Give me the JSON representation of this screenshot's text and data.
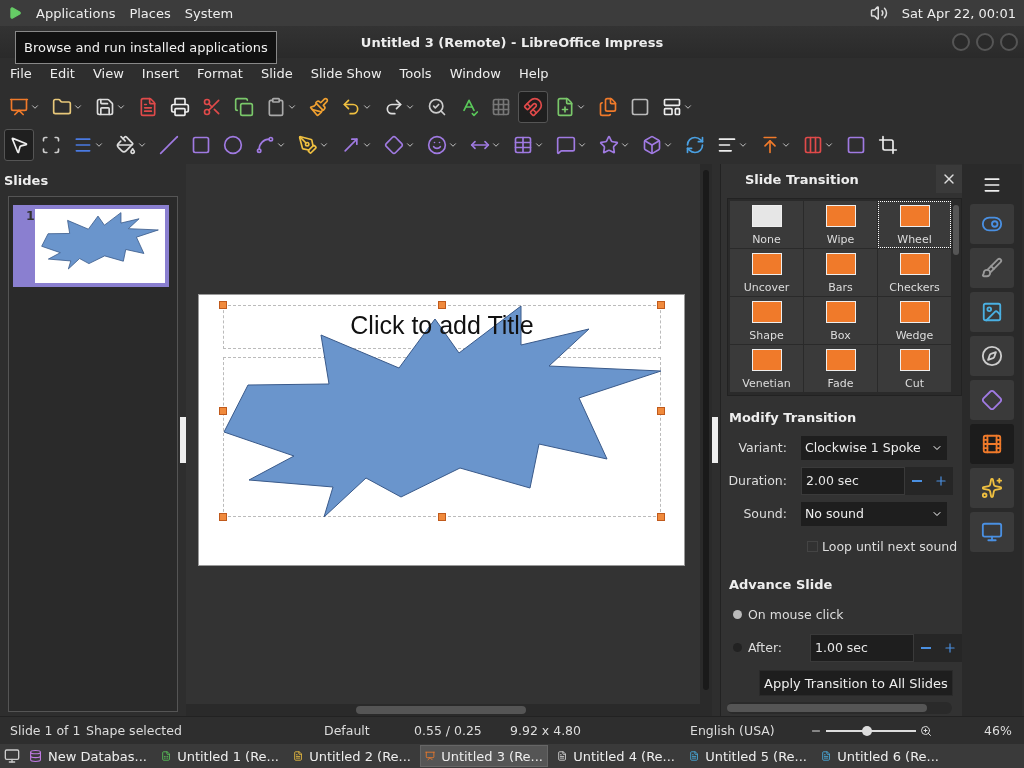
{
  "top_panel": {
    "menus": [
      "Applications",
      "Places",
      "System"
    ],
    "clock": "Sat Apr 22, 00:01"
  },
  "tooltip": "Browse and run installed applications",
  "window": {
    "title": "Untitled 3 (Remote) - LibreOffice Impress"
  },
  "menu_bar": [
    "File",
    "Edit",
    "View",
    "Insert",
    "Format",
    "Slide",
    "Slide Show",
    "Tools",
    "Window",
    "Help"
  ],
  "standard_toolbar": [
    {
      "dropdown": true,
      "pressed": false
    },
    {
      "dropdown": true,
      "pressed": false
    },
    {
      "dropdown": true,
      "pressed": false
    },
    {
      "dropdown": false,
      "pressed": false
    },
    {
      "dropdown": false,
      "pressed": false
    },
    {
      "dropdown": false,
      "pressed": false
    },
    {
      "dropdown": false,
      "pressed": false
    },
    {
      "dropdown": true,
      "pressed": false
    },
    {
      "dropdown": false,
      "pressed": false
    },
    {
      "dropdown": true,
      "pressed": false
    },
    {
      "dropdown": true,
      "pressed": false
    },
    {
      "dropdown": false,
      "pressed": false
    },
    {
      "dropdown": false,
      "pressed": false
    },
    {
      "dropdown": false,
      "pressed": false
    },
    {
      "dropdown": false,
      "pressed": true
    },
    {
      "dropdown": true,
      "pressed": false
    },
    {
      "dropdown": false,
      "pressed": false
    },
    {
      "dropdown": false,
      "pressed": false
    },
    {
      "dropdown": true,
      "pressed": false
    }
  ],
  "drawing_toolbar": [
    {
      "dropdown": false,
      "pressed": true
    },
    {
      "dropdown": false,
      "pressed": false
    },
    {
      "dropdown": true,
      "pressed": false
    },
    {
      "dropdown": true,
      "pressed": false
    },
    {
      "dropdown": false,
      "pressed": false
    },
    {
      "dropdown": false,
      "pressed": false
    },
    {
      "dropdown": false,
      "pressed": false
    },
    {
      "dropdown": true,
      "pressed": false
    },
    {
      "dropdown": true,
      "pressed": false
    },
    {
      "dropdown": true,
      "pressed": false
    },
    {
      "dropdown": true,
      "pressed": false
    },
    {
      "dropdown": true,
      "pressed": false
    },
    {
      "dropdown": true,
      "pressed": false
    },
    {
      "dropdown": true,
      "pressed": false
    },
    {
      "dropdown": true,
      "pressed": false
    },
    {
      "dropdown": true,
      "pressed": false
    },
    {
      "dropdown": true,
      "pressed": false
    },
    {
      "dropdown": false,
      "pressed": false
    },
    {
      "dropdown": true,
      "pressed": false
    },
    {
      "dropdown": true,
      "pressed": false
    },
    {
      "dropdown": true,
      "pressed": false
    },
    {
      "dropdown": false,
      "pressed": false
    },
    {
      "dropdown": false,
      "pressed": false
    }
  ],
  "slides_pane": {
    "title": "Slides",
    "slides": [
      {
        "number": "1",
        "selected": true
      }
    ]
  },
  "slide": {
    "title_placeholder": "Click to add Title"
  },
  "sidebar": {
    "title": "Slide Transition",
    "transitions": [
      {
        "label": "None",
        "selected": false
      },
      {
        "label": "Wipe",
        "selected": false
      },
      {
        "label": "Wheel",
        "selected": true
      },
      {
        "label": "Uncover",
        "selected": false
      },
      {
        "label": "Bars",
        "selected": false
      },
      {
        "label": "Checkers",
        "selected": false
      },
      {
        "label": "Shape",
        "selected": false
      },
      {
        "label": "Box",
        "selected": false
      },
      {
        "label": "Wedge",
        "selected": false
      },
      {
        "label": "Venetian",
        "selected": false
      },
      {
        "label": "Fade",
        "selected": false
      },
      {
        "label": "Cut",
        "selected": false
      }
    ],
    "modify_title": "Modify Transition",
    "variant": {
      "label": "Variant:",
      "value": "Clockwise 1 Spoke"
    },
    "duration": {
      "label": "Duration:",
      "value": "2.00 sec"
    },
    "sound": {
      "label": "Sound:",
      "value": "No sound"
    },
    "loop": {
      "label": "Loop until next sound",
      "checked": false
    },
    "advance_title": "Advance Slide",
    "advance": [
      {
        "label": "On mouse click",
        "selected": true
      },
      {
        "label": "After:",
        "selected": false
      }
    ],
    "after_value": "1.00 sec",
    "apply_button": "Apply Transition to All Slides"
  },
  "sidebar_tabs": [
    {
      "selected": false
    },
    {
      "selected": false
    },
    {
      "selected": false
    },
    {
      "selected": false
    },
    {
      "selected": false
    },
    {
      "selected": true
    },
    {
      "selected": false
    },
    {
      "selected": false
    }
  ],
  "status_bar": {
    "slide": "Slide 1 of 1",
    "selection": "Shape selected",
    "master": "Default",
    "position": "0.55 / 0.25",
    "size": "9.92 x 4.80",
    "language": "English (USA)",
    "zoom": "46%",
    "zoom_level": {
      "level": 0.45
    }
  },
  "taskbar": [
    {
      "label": "New Databas...",
      "selected": false
    },
    {
      "label": "Untitled 1 (Re...",
      "selected": false
    },
    {
      "label": "Untitled 2 (Re...",
      "selected": false
    },
    {
      "label": "Untitled 3 (Re...",
      "selected": true
    },
    {
      "label": "Untitled 4 (Re...",
      "selected": false
    },
    {
      "label": "Untitled 5 (Re...",
      "selected": false
    },
    {
      "label": "Untitled 6 (Re...",
      "selected": false
    }
  ]
}
